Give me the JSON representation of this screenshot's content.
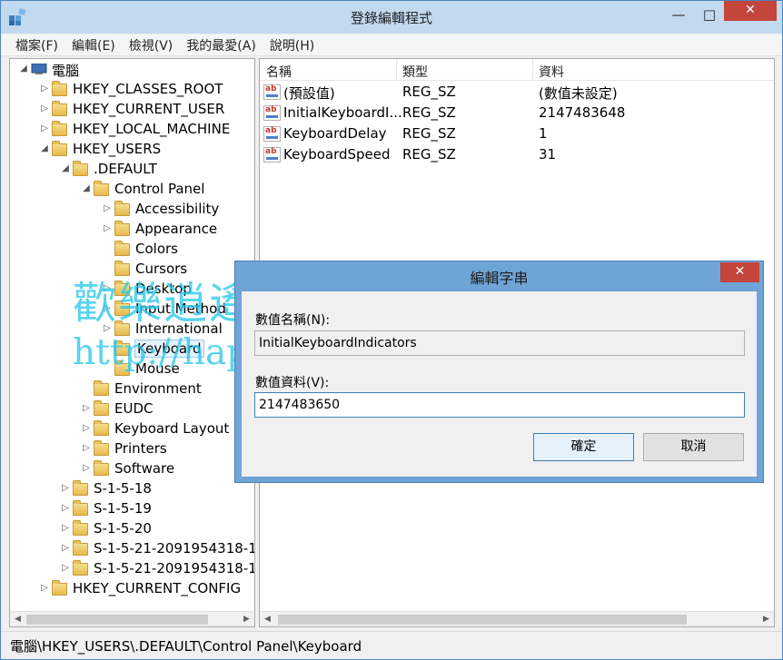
{
  "window": {
    "title": "登錄編輯程式",
    "min": "—",
    "max": "□",
    "close": "✕"
  },
  "menu": [
    "檔案(F)",
    "編輯(E)",
    "檢視(V)",
    "我的最愛(A)",
    "說明(H)"
  ],
  "tree": [
    {
      "label": "電腦",
      "icon": "computer-icon",
      "arrow": "◢",
      "depth": 0
    },
    {
      "label": "HKEY_CLASSES_ROOT",
      "arrow": "▷",
      "depth": 1
    },
    {
      "label": "HKEY_CURRENT_USER",
      "arrow": "▷",
      "depth": 1
    },
    {
      "label": "HKEY_LOCAL_MACHINE",
      "arrow": "▷",
      "depth": 1
    },
    {
      "label": "HKEY_USERS",
      "arrow": "◢",
      "depth": 1
    },
    {
      "label": ".DEFAULT",
      "arrow": "◢",
      "depth": 2
    },
    {
      "label": "Control Panel",
      "arrow": "◢",
      "depth": 3
    },
    {
      "label": "Accessibility",
      "arrow": "▷",
      "depth": 4
    },
    {
      "label": "Appearance",
      "arrow": "▷",
      "depth": 4
    },
    {
      "label": "Colors",
      "arrow": "",
      "depth": 4
    },
    {
      "label": "Cursors",
      "arrow": "",
      "depth": 4
    },
    {
      "label": "Desktop",
      "arrow": "▷",
      "depth": 4
    },
    {
      "label": "Input Method",
      "arrow": "▷",
      "depth": 4
    },
    {
      "label": "International",
      "arrow": "▷",
      "depth": 4
    },
    {
      "label": "Keyboard",
      "arrow": "",
      "depth": 4,
      "selected": true
    },
    {
      "label": "Mouse",
      "arrow": "",
      "depth": 4
    },
    {
      "label": "Environment",
      "arrow": "",
      "depth": 3
    },
    {
      "label": "EUDC",
      "arrow": "▷",
      "depth": 3
    },
    {
      "label": "Keyboard Layout",
      "arrow": "▷",
      "depth": 3
    },
    {
      "label": "Printers",
      "arrow": "▷",
      "depth": 3
    },
    {
      "label": "Software",
      "arrow": "▷",
      "depth": 3
    },
    {
      "label": "S-1-5-18",
      "arrow": "▷",
      "depth": 2
    },
    {
      "label": "S-1-5-19",
      "arrow": "▷",
      "depth": 2
    },
    {
      "label": "S-1-5-20",
      "arrow": "▷",
      "depth": 2
    },
    {
      "label": "S-1-5-21-2091954318-1",
      "arrow": "▷",
      "depth": 2
    },
    {
      "label": "S-1-5-21-2091954318-1",
      "arrow": "▷",
      "depth": 2
    },
    {
      "label": "HKEY_CURRENT_CONFIG",
      "arrow": "▷",
      "depth": 1
    }
  ],
  "list": {
    "columns": [
      "名稱",
      "類型",
      "資料"
    ],
    "rows": [
      {
        "name": "(預設值)",
        "type": "REG_SZ",
        "data": "(數值未設定)"
      },
      {
        "name": "InitialKeyboardI...",
        "type": "REG_SZ",
        "data": "2147483648"
      },
      {
        "name": "KeyboardDelay",
        "type": "REG_SZ",
        "data": "1"
      },
      {
        "name": "KeyboardSpeed",
        "type": "REG_SZ",
        "data": "31"
      }
    ]
  },
  "status": "電腦\\HKEY_USERS\\.DEFAULT\\Control Panel\\Keyboard",
  "watermark": {
    "text": "歡樂逍遙",
    "url": "http://happyplayblogs.blogspot.tw/"
  },
  "dialog": {
    "title": "編輯字串",
    "close": "✕",
    "name_label": "數值名稱(N):",
    "name_value": "InitialKeyboardIndicators",
    "data_label": "數值資料(V):",
    "data_value": "2147483650",
    "ok": "確定",
    "cancel": "取消"
  },
  "colors": {
    "accent": "#6fa4d6",
    "close": "#c4453c",
    "selection": "#e5f1fb"
  }
}
